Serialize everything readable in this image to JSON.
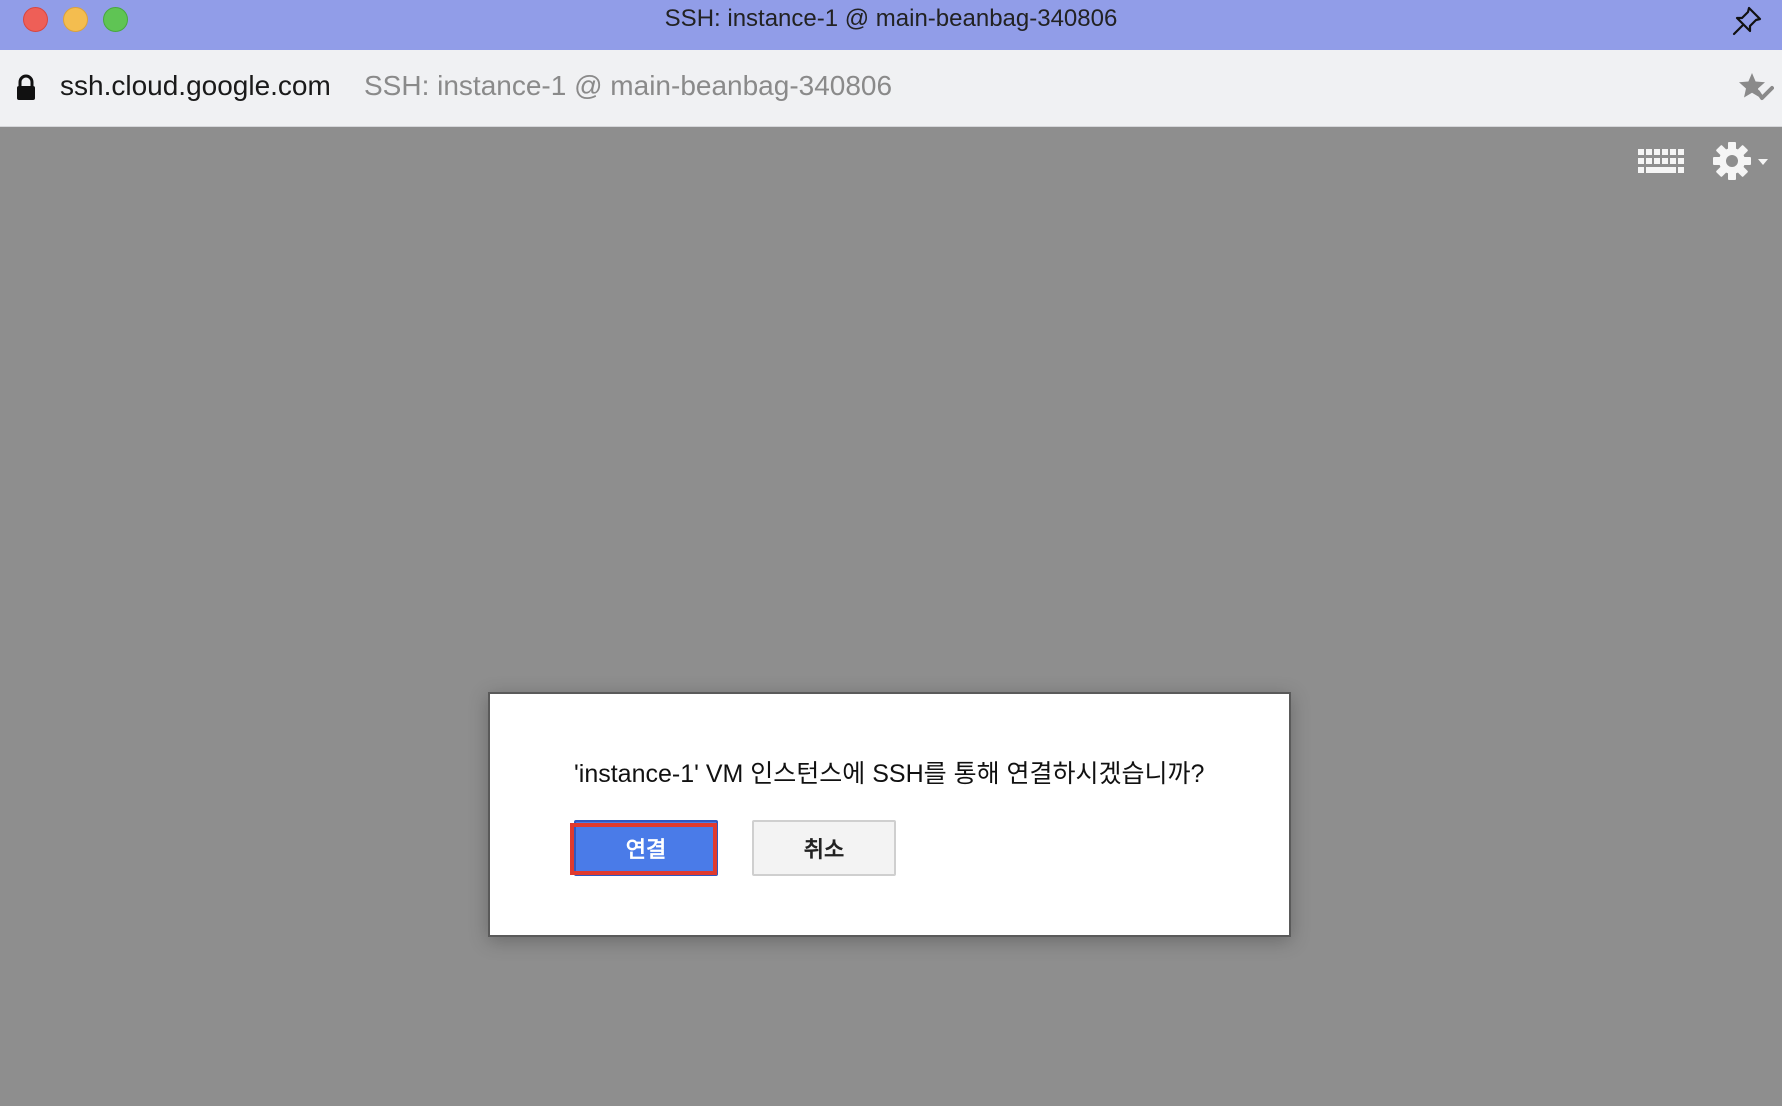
{
  "window": {
    "title": "SSH: instance-1 @ main-beanbag-340806"
  },
  "addressbar": {
    "domain": "ssh.cloud.google.com",
    "page_title": "SSH: instance-1 @ main-beanbag-340806"
  },
  "toolbar": {
    "icons": [
      "keyboard-icon",
      "gear-icon"
    ]
  },
  "dialog": {
    "message": "'instance-1' VM 인스턴스에 SSH를 통해 연결하시겠습니까?",
    "connect_label": "연결",
    "cancel_label": "취소"
  },
  "colors": {
    "titlebar": "#919de8",
    "background": "#8e8e8e",
    "primary_button": "#4a7be8",
    "highlight": "#e03a2f"
  }
}
